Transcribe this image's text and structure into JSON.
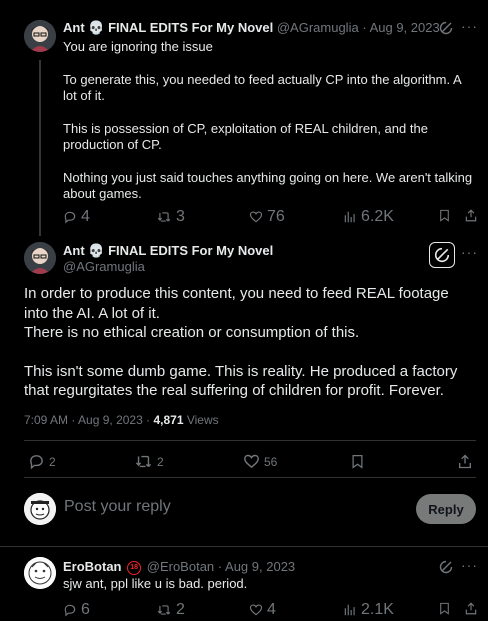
{
  "reply_tweet": {
    "display_name": "Ant 💀 FINAL EDITS For My Novel",
    "handle": "@AGramuglia",
    "date": "Aug 9, 2023",
    "separator": "·",
    "paragraphs": [
      "You are ignoring the issue",
      "To generate this, you needed to feed actually CP into the algorithm. A lot of it.",
      "This is possession of CP, exploitation of REAL children, and the production of CP.",
      "Nothing you just said touches anything going on here. We aren't talking about games."
    ],
    "replies": "4",
    "reposts": "3",
    "likes": "76",
    "views": "6.2K"
  },
  "main_tweet": {
    "display_name": "Ant 💀 FINAL EDITS For My Novel",
    "handle": "@AGramuglia",
    "paragraphs": [
      "In order to produce this content, you need to feed REAL footage into the AI. A lot of it.\nThere is no ethical creation or consumption of this.",
      "This isn't some dumb game. This is reality. He produced a factory that regurgitates the real suffering of children for profit. Forever."
    ],
    "time": "7:09 AM",
    "date": "Aug 9, 2023",
    "separator": "·",
    "views_count": "4,871",
    "views_label": "Views",
    "replies": "2",
    "reposts": "2",
    "likes": "56"
  },
  "composer": {
    "placeholder": "Post your reply",
    "button_label": "Reply"
  },
  "bottom_reply": {
    "display_name": "EroBotan",
    "badge": "18",
    "handle": "@EroBotan",
    "date": "Aug 9, 2023",
    "separator": "·",
    "text": "sjw ant, ppl like u is bad. period.",
    "replies": "6",
    "reposts": "2",
    "likes": "4",
    "views": "2.1K"
  },
  "icons": {
    "reply": "reply-icon",
    "repost": "repost-icon",
    "like": "heart-icon",
    "views": "views-icon",
    "bookmark": "bookmark-icon",
    "share": "share-icon",
    "grok": "grok-icon",
    "more": "more-icon"
  },
  "colors": {
    "background": "#000000",
    "text": "#e7e9ea",
    "muted": "#71767b",
    "divider": "#2f3336",
    "reply_button": "#787a7a",
    "badge": "#f4212e"
  }
}
